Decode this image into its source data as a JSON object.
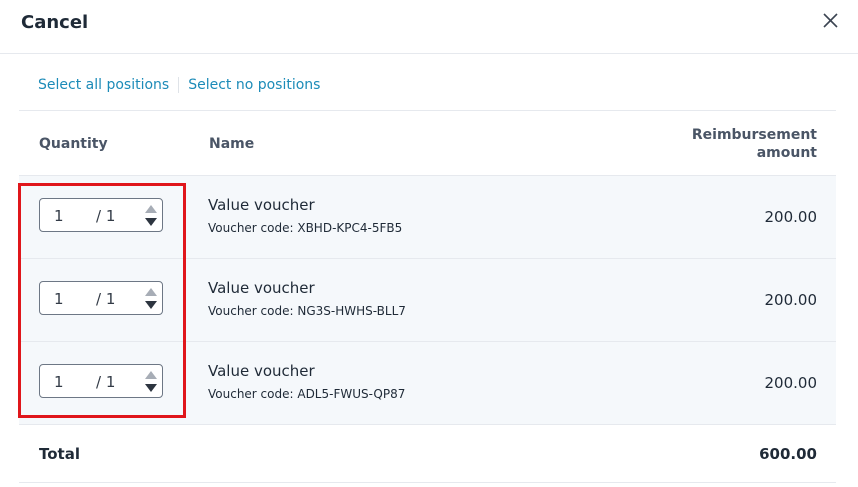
{
  "dialog": {
    "title": "Cancel",
    "close_icon": "close-icon"
  },
  "selection": {
    "select_all": "Select all positions",
    "select_none": "Select no positions"
  },
  "table": {
    "headers": {
      "quantity": "Quantity",
      "name": "Name",
      "reimbursement_line1": "Reimbursement",
      "reimbursement_line2": "amount"
    },
    "rows": [
      {
        "quantity": "1",
        "max": "/ 1",
        "name": "Value voucher",
        "code": "Voucher code: XBHD-KPC4-5FB5",
        "amount": "200.00"
      },
      {
        "quantity": "1",
        "max": "/ 1",
        "name": "Value voucher",
        "code": "Voucher code: NG3S-HWHS-BLL7",
        "amount": "200.00"
      },
      {
        "quantity": "1",
        "max": "/ 1",
        "name": "Value voucher",
        "code": "Voucher code: ADL5-FWUS-QP87",
        "amount": "200.00"
      }
    ],
    "total": {
      "label": "Total",
      "value": "600.00"
    }
  },
  "colors": {
    "link": "#1c8bb8",
    "highlight": "#e0161b",
    "row_bg": "#f5f8fb"
  }
}
